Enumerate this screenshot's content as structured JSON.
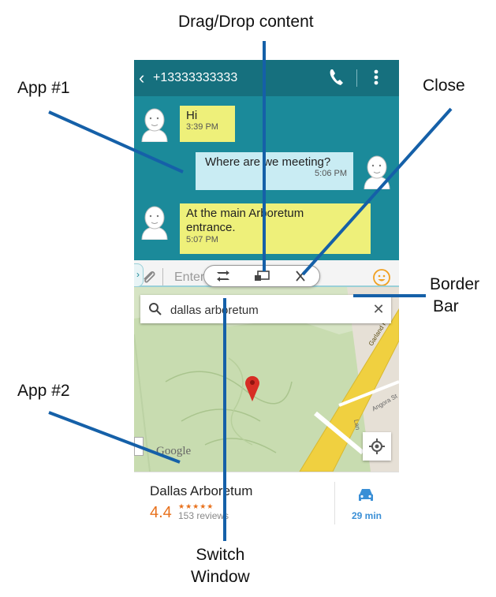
{
  "callouts": {
    "drag_drop": "Drag/Drop content",
    "app1": "App #1",
    "close": "Close",
    "border_bar_line1": "Border",
    "border_bar_line2": "Bar",
    "app2": "App #2",
    "switch_line1": "Switch",
    "switch_line2": "Window"
  },
  "messaging": {
    "back_glyph": "‹",
    "contact_number": "+13333333333",
    "messages": [
      {
        "text": "Hi",
        "time": "3:39 PM",
        "direction": "incoming"
      },
      {
        "text": "Where are we meeting?",
        "time": "5:06 PM",
        "direction": "outgoing"
      },
      {
        "text": "At the main Arboretum entrance.",
        "time": "5:07 PM",
        "direction": "incoming"
      }
    ],
    "input_placeholder": "Enter message"
  },
  "border_bar": {
    "side_tab_glyph": "›"
  },
  "maps": {
    "search_value": "dallas arboretum",
    "clear_glyph": "✕",
    "road_label": "Garland Rd",
    "street_label": "Angora St",
    "lane_label": "Lan",
    "watermark": "Google",
    "place_name": "Dallas Arboretum",
    "rating": "4.4",
    "stars": "★★★★★",
    "reviews": "153 reviews",
    "drive_time": "29 min"
  },
  "colors": {
    "messaging_bg": "#1b8a9a",
    "topbar_bg": "#16707e",
    "incoming_bubble": "#eef07a",
    "outgoing_bubble": "#c9ecf3",
    "callout_line": "#1560a8",
    "rating": "#e8711c",
    "map_park": "#c8dcb0",
    "road": "#f0d040"
  }
}
